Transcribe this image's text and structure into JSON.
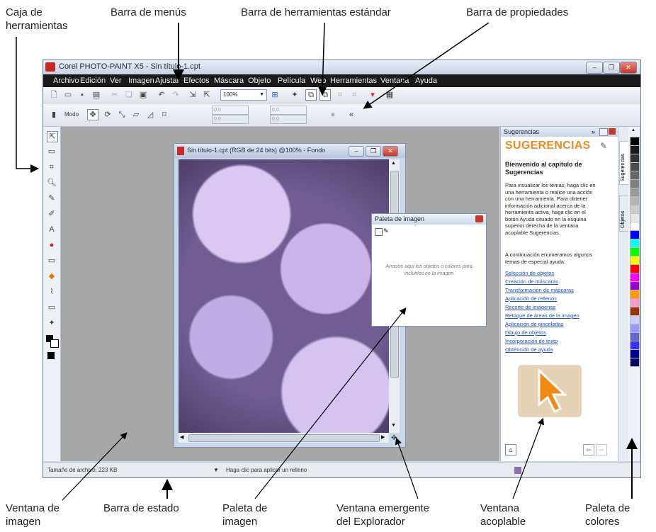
{
  "callouts": {
    "toolbox": "Caja de\nherramientas",
    "menubar": "Barra de menús",
    "standard_toolbar": "Barra de herramientas estándar",
    "property_bar": "Barra de propiedades",
    "image_window": "Ventana de\nimagen",
    "status_bar": "Barra de estado",
    "image_palette": "Paleta de\nimagen",
    "navigator_popup": "Ventana emergente\ndel Explorador",
    "docker": "Ventana\nacoplable",
    "color_palette": "Paleta de\ncolores"
  },
  "app": {
    "title": "Corel PHOTO-PAINT X5 - Sin título-1.cpt",
    "menus": [
      "Archivo",
      "Edición",
      "Ver",
      "Imagen",
      "Ajustar",
      "Efectos",
      "Máscara",
      "Objeto",
      "Película",
      "Web",
      "Herramientas",
      "Ventana",
      "Ayuda"
    ],
    "zoom_value": "100%",
    "property_mode_label": "Modo",
    "property_values": [
      "0.0",
      "0.0",
      "0.0",
      "0.0"
    ]
  },
  "image_window": {
    "title": "Sin título-1.cpt (RGB de 24 bits) @100% - Fondo"
  },
  "image_palette": {
    "title": "Paleta de imagen",
    "hint": "Arrastre aquí los objetos o colores para incluirlos en la imagen"
  },
  "docker": {
    "tab_title": "Sugerencias",
    "header": "SUGERENCIAS",
    "welcome": "Bienvenido al capítulo de Sugerencias",
    "intro": "Para visualizar los temas, haga clic en una herramienta o realice una acción con una herramienta. Para obtener información adicional acerca de la herramienta activa, haga clic en el botón Ayuda situado en la esquina superior derecha de la ventana acoplable Sugerencias.",
    "list_intro": "A continuación enumeramos algunos temas de especial ayuda:",
    "links": [
      "Selección de objetos",
      "Creación de máscaras",
      "Transformación de máscaras",
      "Aplicación de rellenos",
      "Recorte de imágenes",
      "Retoque de áreas de la imagen",
      "Aplicación de pinceladas",
      "Dibujo de objetos",
      "Incorporación de texto",
      "Obtención de ayuda"
    ],
    "side_tabs": [
      "Sugerencias",
      "Objetos"
    ]
  },
  "colors": [
    "#000000",
    "#1a1a1a",
    "#333333",
    "#4d4d4d",
    "#666666",
    "#808080",
    "#999999",
    "#b3b3b3",
    "#cccccc",
    "#e6e6e6",
    "#ffffff",
    "#0000ff",
    "#00ffff",
    "#00ff00",
    "#ffff00",
    "#ff0000",
    "#ff00ff",
    "#9900cc",
    "#ff9900",
    "#ff99cc",
    "#993300",
    "#ccccff",
    "#9999ff",
    "#6666cc",
    "#3333ff",
    "#000099",
    "#000066"
  ],
  "status": {
    "file_size": "Tamaño de archivo: 223 KB",
    "hint": "Haga clic para aplicar un relleno"
  }
}
